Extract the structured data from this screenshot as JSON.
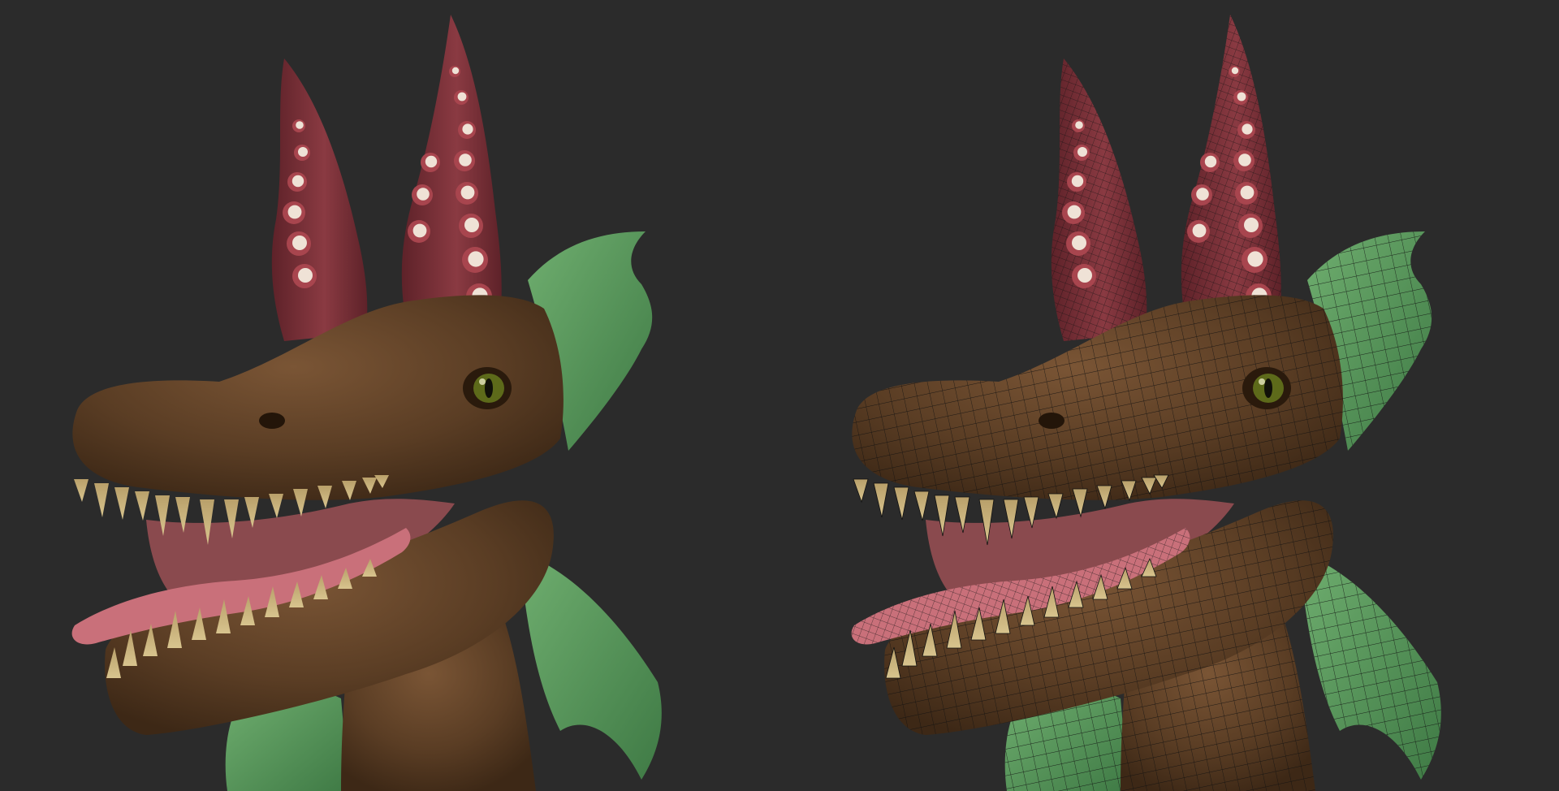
{
  "scene": {
    "background": "#2b2b2b",
    "views": [
      {
        "id": "shaded",
        "label": ""
      },
      {
        "id": "wireframe",
        "label": ""
      }
    ]
  },
  "colors": {
    "skin": "#5a3d24",
    "skin_dark": "#3d2816",
    "skin_light": "#7a5535",
    "horn": "#8a3a42",
    "horn_dark": "#5e2229",
    "sucker_rim": "#a8454e",
    "sucker_center": "#efe2d6",
    "fin": "#3f7a45",
    "fin_light": "#6fae6f",
    "tooth": "#d8c48e",
    "tongue": "#c9707a",
    "mouth": "#8a4a4e",
    "eye": "#5d6a1a",
    "wire": "#111111"
  }
}
